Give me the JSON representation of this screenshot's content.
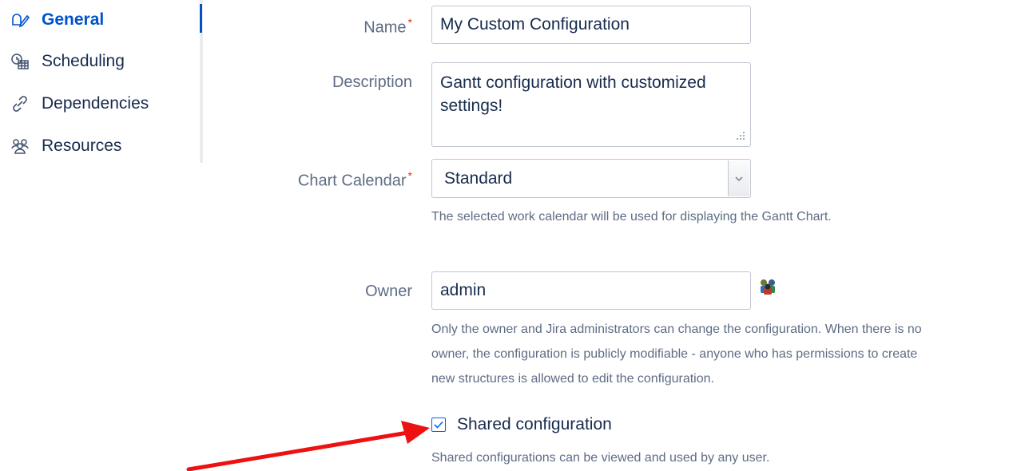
{
  "sidebar": {
    "items": [
      {
        "label": "General",
        "icon": "pencil-edit-icon",
        "active": true
      },
      {
        "label": "Scheduling",
        "icon": "calendar-clock-icon",
        "active": false
      },
      {
        "label": "Dependencies",
        "icon": "link-icon",
        "active": false
      },
      {
        "label": "Resources",
        "icon": "people-group-icon",
        "active": false
      }
    ]
  },
  "form": {
    "name": {
      "label": "Name",
      "required_mark": "*",
      "value": "My Custom Configuration"
    },
    "description": {
      "label": "Description",
      "value": "Gantt configuration with customized settings!"
    },
    "chart_calendar": {
      "label": "Chart Calendar",
      "required_mark": "*",
      "value": "Standard",
      "help": "The selected work calendar will be used for displaying the Gantt Chart."
    },
    "owner": {
      "label": "Owner",
      "value": "admin",
      "help_lines": [
        "Only the owner and Jira administrators can change the configuration. When there is no",
        "owner, the configuration is publicly modifiable - anyone who has permissions to create",
        "new structures is allowed to edit the configuration."
      ]
    },
    "shared": {
      "label": "Shared configuration",
      "checked": true,
      "help": "Shared configurations can be viewed and used by any user."
    }
  },
  "colors": {
    "accent": "#0052cc",
    "required": "#de350b",
    "annotation_arrow": "#ee1111"
  }
}
